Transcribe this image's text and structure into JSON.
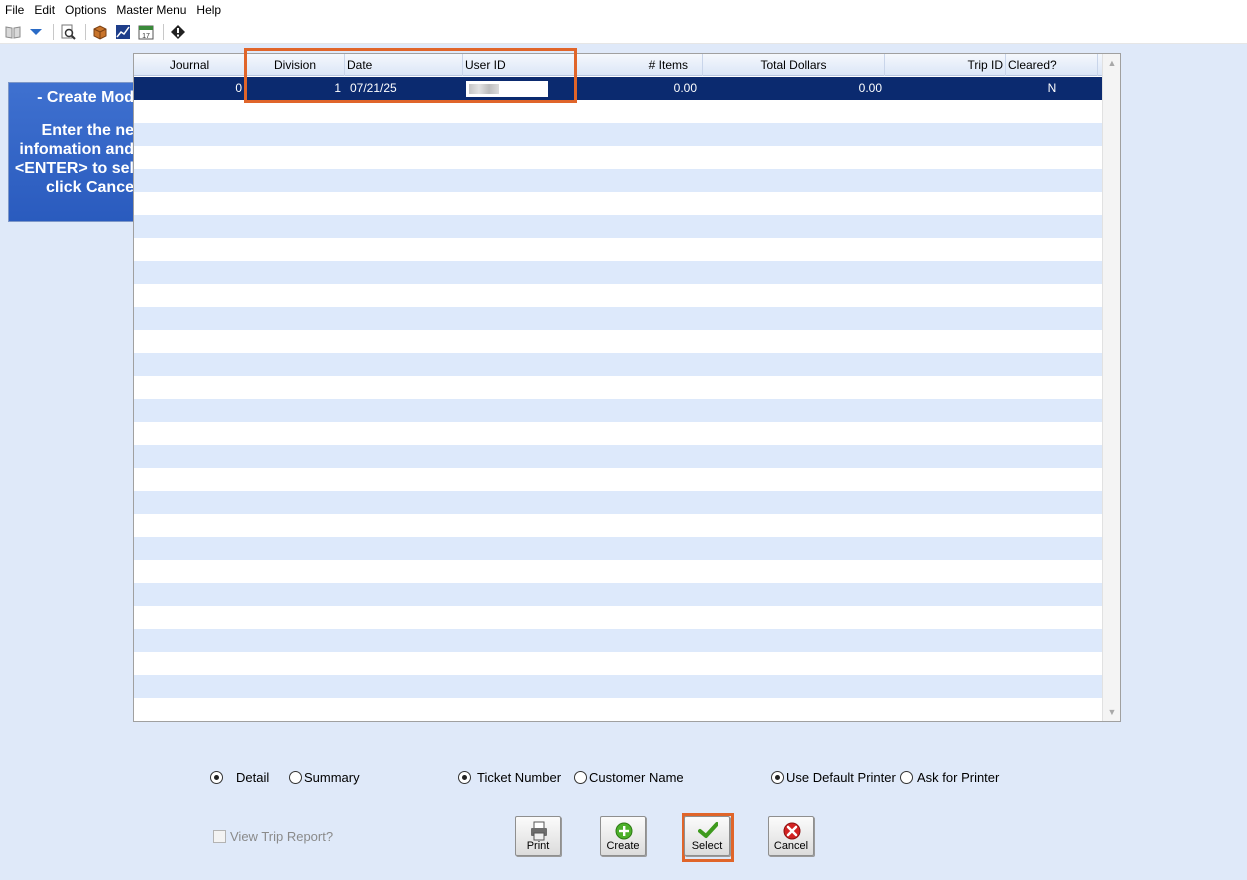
{
  "menu": [
    "File",
    "Edit",
    "Options",
    "Master Menu",
    "Help"
  ],
  "toolbar_icons": [
    "book-open-icon",
    "dropdown-arrow-icon",
    "print-preview-icon",
    "box-icon",
    "chart-icon",
    "calendar-icon",
    "info-diamond-icon"
  ],
  "side_panel": {
    "title": "- Create Mod",
    "lines": [
      "Enter the ne",
      "infomation and",
      "<ENTER> to sel",
      "click Cance"
    ]
  },
  "grid": {
    "columns": [
      "Journal",
      "Division",
      "Date",
      "User ID",
      "# Items",
      "Total Dollars",
      "Trip ID",
      "Cleared?"
    ],
    "rows": [
      {
        "journal": "0",
        "division": "1",
        "date": "07/21/25",
        "user_id": "",
        "items": "0.00",
        "total_dollars": "0.00",
        "trip_id": "",
        "cleared": "N"
      }
    ],
    "empty_row_count": 27
  },
  "options": {
    "detail": "Detail",
    "summary": "Summary",
    "ticket_number": "Ticket Number",
    "customer_name": "Customer Name",
    "use_default_printer": "Use Default Printer",
    "ask_for_printer": "Ask for Printer",
    "view_trip_report": "View Trip Report?"
  },
  "buttons": {
    "print": "Print",
    "create": "Create",
    "select": "Select",
    "cancel": "Cancel"
  },
  "colors": {
    "highlight": "#e0652a",
    "selected_row": "#0b2a6f",
    "panel_blue": "#3366cc",
    "background": "#dfe9f9"
  }
}
